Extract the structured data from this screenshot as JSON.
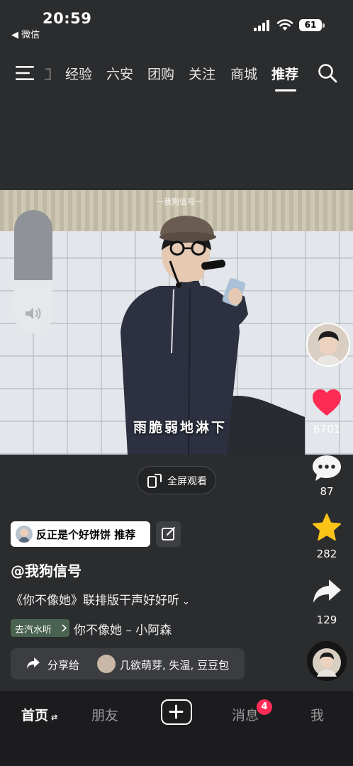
{
  "status": {
    "time": "20:59",
    "back_app": "◀ 微信",
    "battery": "61"
  },
  "nav": {
    "items": [
      "经验",
      "六安",
      "团购",
      "关注",
      "商城"
    ],
    "active": "推荐",
    "partial": "卫"
  },
  "video": {
    "watermark": "一我狗信号一",
    "subtitle": "雨脆弱地淋下",
    "volume_level": 0.57
  },
  "actions": {
    "likes": "6701",
    "comments": "87",
    "favorites": "282",
    "shares": "129"
  },
  "fullscreen": {
    "label": "全屏观看"
  },
  "recommend_chip": {
    "label": "反正是个好饼饼 推荐"
  },
  "author": {
    "handle": "@我狗信号"
  },
  "description": "《你不像她》联排版干声好好听",
  "music": {
    "chip": "去汽水听",
    "name": "你不像她 – 小阿森"
  },
  "share_bar": {
    "label": "分享给",
    "names": "几欲萌芽, 失温, 豆豆包"
  },
  "tabbar": {
    "home": "首页",
    "friends": "朋友",
    "messages": "消息",
    "me": "我",
    "badge": "4"
  },
  "colors": {
    "like": "#fe2c55",
    "star": "#fcc419",
    "background": "#2b2c2e"
  }
}
